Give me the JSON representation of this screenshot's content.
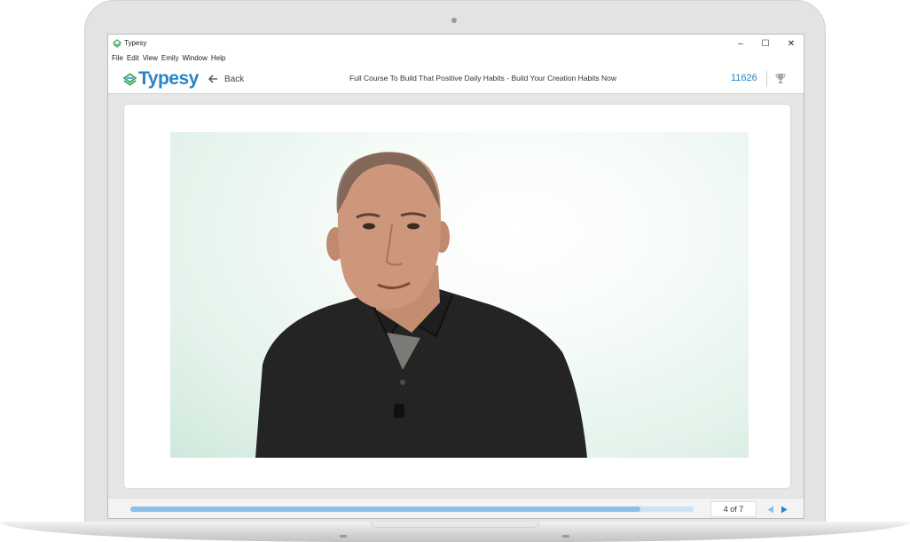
{
  "window": {
    "app_title": "Typesy",
    "controls": {
      "minimize": "–",
      "maximize": "☐",
      "close": "✕"
    }
  },
  "menu": [
    "File",
    "Edit",
    "View",
    "Emily",
    "Window",
    "Help"
  ],
  "toolbar": {
    "logo_text": "Typesy",
    "back_label": "Back",
    "course_title": "Full Course To Build That Positive Daily Habits - Build Your Creation Habits Now",
    "points": "11626",
    "trophy_icon": "trophy-icon"
  },
  "player": {
    "progress": 0.905,
    "page_indicator": "4 of 7",
    "prev_icon": "triangle-left-icon",
    "next_icon": "triangle-right-icon"
  },
  "colors": {
    "brand": "#2a84c6",
    "progress_fill": "#8cc0e8",
    "progress_track": "#cfe2f2"
  }
}
